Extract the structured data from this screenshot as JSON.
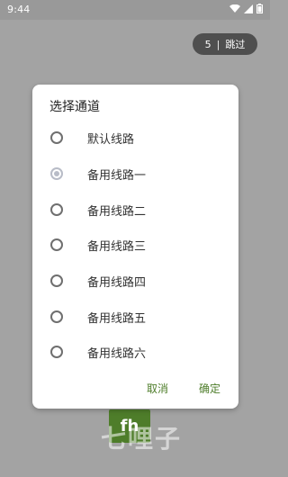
{
  "status_bar": {
    "time": "9:44",
    "icons": [
      "wifi-icon",
      "signal-icon",
      "battery-icon"
    ]
  },
  "splash": {
    "skip": {
      "countdown": "5",
      "separator": "|",
      "label": "跳过"
    },
    "logo_text": "fh",
    "watermark_text": "七哩子"
  },
  "dialog": {
    "title": "选择通道",
    "options": [
      {
        "label": "默认线路",
        "selected": false
      },
      {
        "label": "备用线路一",
        "selected": true
      },
      {
        "label": "备用线路二",
        "selected": false
      },
      {
        "label": "备用线路三",
        "selected": false
      },
      {
        "label": "备用线路四",
        "selected": false
      },
      {
        "label": "备用线路五",
        "selected": false
      },
      {
        "label": "备用线路六",
        "selected": false
      }
    ],
    "cancel_label": "取消",
    "confirm_label": "确定"
  },
  "colors": {
    "accent": "#4e7d2a",
    "radio_selected": "#b8bcc7",
    "radio_unselected": "#6f6f6f",
    "scrim": "#a3a3a3"
  }
}
